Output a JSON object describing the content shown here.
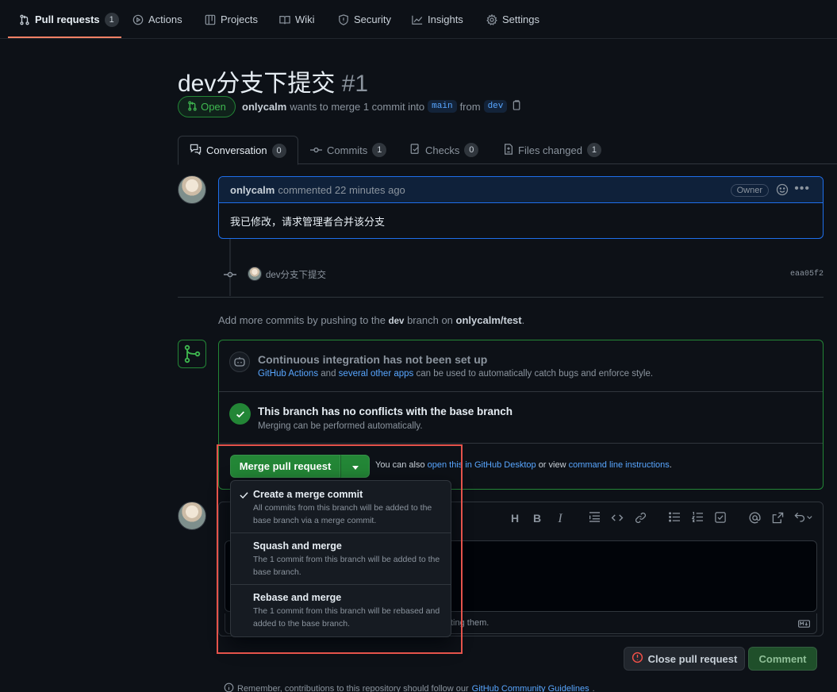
{
  "nav": {
    "tabs": [
      {
        "label": "Pull requests",
        "count": "1"
      },
      {
        "label": "Actions"
      },
      {
        "label": "Projects"
      },
      {
        "label": "Wiki"
      },
      {
        "label": "Security"
      },
      {
        "label": "Insights"
      },
      {
        "label": "Settings"
      }
    ]
  },
  "pr": {
    "title": "dev分支下提交",
    "number": "#1",
    "state": "Open",
    "author": "onlycalm",
    "merge_text": "wants to merge 1 commit into",
    "base_branch": "main",
    "from_text": "from",
    "head_branch": "dev"
  },
  "pr_tabs": [
    {
      "label": "Conversation",
      "count": "0"
    },
    {
      "label": "Commits",
      "count": "1"
    },
    {
      "label": "Checks",
      "count": "0"
    },
    {
      "label": "Files changed",
      "count": "1"
    }
  ],
  "comment": {
    "author": "onlycalm",
    "action": "commented 22 minutes ago",
    "role": "Owner",
    "body": "我已修改，请求管理者合并该分支"
  },
  "commit": {
    "message": "dev分支下提交",
    "sha": "eaa05f2"
  },
  "add_commits": {
    "prefix": "Add more commits by pushing to the",
    "branch": "dev",
    "middle": "branch on",
    "repo": "onlycalm/test",
    "suffix": "."
  },
  "ci": {
    "title": "Continuous integration has not been set up",
    "link1": "GitHub Actions",
    "and": "and",
    "link2": "several other apps",
    "rest": "can be used to automatically catch bugs and enforce style."
  },
  "conflicts": {
    "title": "This branch has no conflicts with the base branch",
    "subtitle": "Merging can be performed automatically."
  },
  "merge": {
    "button": "Merge pull request",
    "also": "You can also",
    "link_desktop": "open this in GitHub Desktop",
    "or_view": "or view",
    "link_cli": "command line instructions",
    "period": "."
  },
  "merge_options": [
    {
      "title": "Create a merge commit",
      "desc": "All commits from this branch will be added to the base branch via a merge commit.",
      "selected": true
    },
    {
      "title": "Squash and merge",
      "desc": "The 1 commit from this branch will be added to the base branch."
    },
    {
      "title": "Rebase and merge",
      "desc": "The 1 commit from this branch will be rebased and added to the base branch."
    }
  ],
  "editor": {
    "footer_partial": "ting them."
  },
  "actions": {
    "close": "Close pull request",
    "comment": "Comment"
  },
  "footer": {
    "text": "Remember, contributions to this repository should follow our",
    "link": "GitHub Community Guidelines",
    "period": "."
  },
  "colors": {
    "accent_green": "#238636",
    "link_blue": "#58a6ff",
    "highlight_red": "#e5534b",
    "tab_underline": "#f78166"
  }
}
